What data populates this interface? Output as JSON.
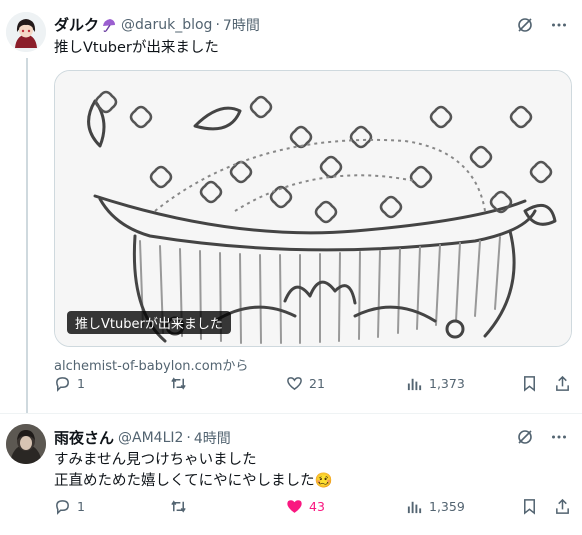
{
  "tweets": [
    {
      "name": "ダルク",
      "handle": "@daruk_blog",
      "separator": "·",
      "time": "7時間",
      "text": [
        "推しVtuberが出来ました"
      ],
      "card": {
        "caption": "推しVtuberが出来ました",
        "source": "alchemist-of-babylon.comから"
      },
      "actions": {
        "replies": "1",
        "retweets": "",
        "likes": "21",
        "views": "1,373"
      }
    },
    {
      "name": "雨夜さん",
      "handle": "@AM4LI2",
      "separator": "·",
      "time": "4時間",
      "text": [
        "すみません見つけちゃいました",
        "正直めためた嬉しくてにやにやしました🥴"
      ],
      "actions": {
        "replies": "1",
        "retweets": "",
        "likes": "43",
        "views": "1,359",
        "liked": true
      }
    }
  ],
  "colors": {
    "like_active": "#f91880",
    "secondary_text": "#536471"
  },
  "icons": [
    "grok-icon",
    "more-icon",
    "reply-icon",
    "retweet-icon",
    "like-icon",
    "views-icon",
    "bookmark-icon",
    "share-icon",
    "umbrella-badge-icon"
  ]
}
